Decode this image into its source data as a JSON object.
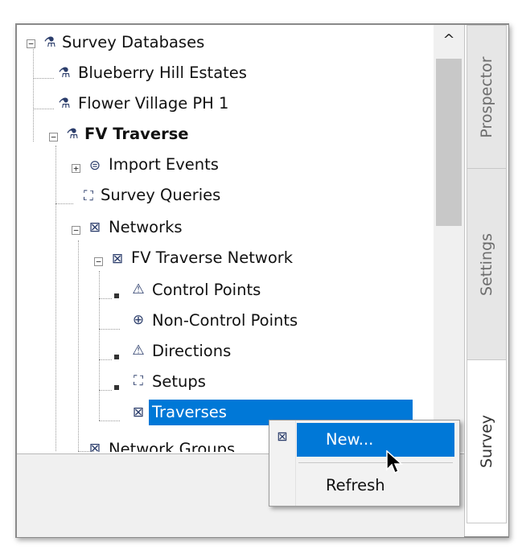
{
  "tree": {
    "root": {
      "label": "Survey Databases",
      "icon": "survey-database-icon"
    },
    "items": [
      {
        "label": "Blueberry Hill Estates",
        "icon": "survey-database-icon"
      },
      {
        "label": "Flower Village PH 1",
        "icon": "survey-database-icon"
      },
      {
        "label": "FV Traverse",
        "icon": "survey-database-icon",
        "bold": true
      },
      {
        "label": "Import Events",
        "icon": "import-events-icon"
      },
      {
        "label": "Survey Queries",
        "icon": "survey-queries-icon"
      },
      {
        "label": "Networks",
        "icon": "network-icon"
      },
      {
        "label": "FV Traverse Network",
        "icon": "network-icon"
      },
      {
        "label": "Control Points",
        "icon": "control-points-icon"
      },
      {
        "label": "Non-Control Points",
        "icon": "non-control-points-icon"
      },
      {
        "label": "Directions",
        "icon": "directions-icon"
      },
      {
        "label": "Setups",
        "icon": "setups-icon"
      },
      {
        "label": "Traverses",
        "icon": "traverses-icon",
        "selected": true
      },
      {
        "label": "Network Groups",
        "icon": "network-groups-icon"
      }
    ]
  },
  "tabs": [
    "Prospector",
    "Settings",
    "Survey"
  ],
  "active_tab": "Survey",
  "context_menu": {
    "items": [
      {
        "label": "New...",
        "highlighted": true
      },
      {
        "label": "Refresh",
        "highlighted": false
      }
    ]
  },
  "colors": {
    "selection": "#0078d7",
    "scroll_thumb": "#c8c8c8"
  }
}
